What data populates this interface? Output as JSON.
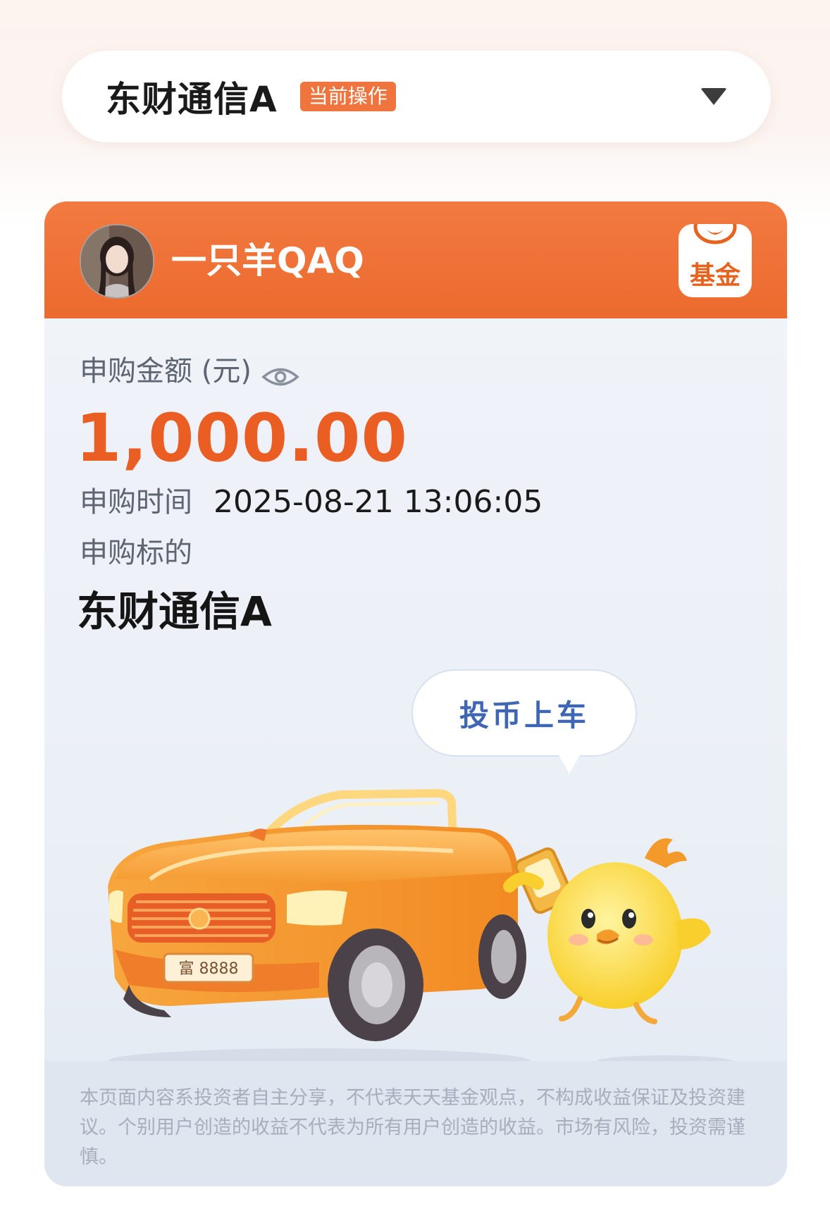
{
  "selector": {
    "fund_name": "东财通信A",
    "badge": "当前操作"
  },
  "card": {
    "username": "一只羊QAQ",
    "fund_logo_text": "基金",
    "amount_label": "申购金额 (元)",
    "amount": "1,000.00",
    "time_label": "申购时间",
    "time_value": "2025-08-21 13:06:05",
    "target_label": "申购标的",
    "target_value": "东财通信A",
    "bubble_text": "投币上车",
    "license_plate": "富 8888",
    "disclaimer": "本页面内容系投资者自主分享，不代表天天基金观点，不构成收益保证及投资建议。个别用户创造的收益不代表为所有用户创造的收益。市场有风险，投资需谨慎。"
  },
  "colors": {
    "accent": "#ec6a2e",
    "amount": "#ea5d23",
    "bubble_text": "#3e66b4"
  },
  "icons": [
    "chevron-down-icon",
    "eye-icon",
    "fund-logo-icon"
  ]
}
